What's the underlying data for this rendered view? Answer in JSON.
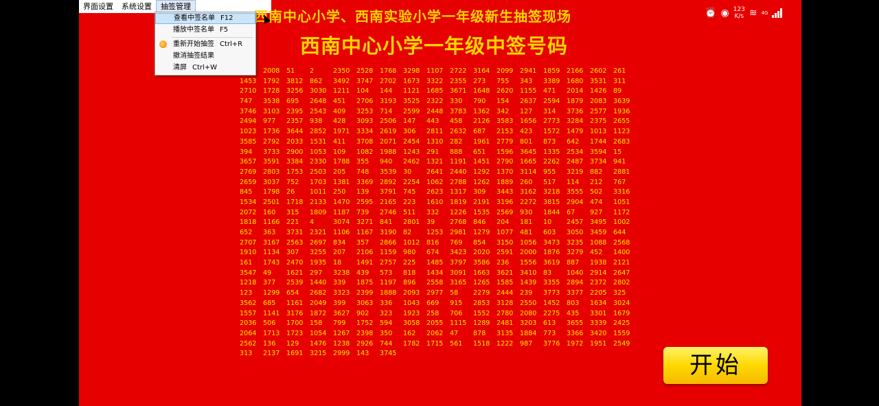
{
  "menubar": {
    "items": [
      "界面设置",
      "系统设置",
      "抽签管理"
    ]
  },
  "dropdown": {
    "items": [
      {
        "label": "查看中签名单",
        "shortcut": "F12"
      },
      {
        "label": "播放中签名单",
        "shortcut": "F5"
      },
      {
        "label": "重新开始抽签",
        "shortcut": "Ctrl+R"
      },
      {
        "label": "撤消抽签结果",
        "shortcut": ""
      },
      {
        "label": "清屏",
        "shortcut": "Ctrl+W"
      }
    ]
  },
  "title1": "西南中心小学、西南实验小学一年级新生抽签现场",
  "title2": "西南中心小学一年级中签号码",
  "start_button": "开始",
  "status": {
    "speed_value": "123",
    "speed_unit": "K/s",
    "network": "4G"
  },
  "numbers": [
    2008,
    51,
    2,
    2350,
    2528,
    1768,
    3298,
    1107,
    2722,
    3164,
    2099,
    2941,
    1859,
    2166,
    2602,
    261,
    1453,
    1792,
    3812,
    862,
    3492,
    3747,
    2702,
    1673,
    3322,
    2355,
    273,
    755,
    343,
    3389,
    1680,
    3531,
    311,
    2710,
    1728,
    3256,
    3030,
    1211,
    104,
    144,
    1121,
    1685,
    3671,
    1648,
    2620,
    1155,
    471,
    2014,
    1426,
    89,
    747,
    3538,
    695,
    2648,
    451,
    2706,
    3193,
    3525,
    2322,
    330,
    790,
    154,
    2637,
    2594,
    1879,
    2083,
    3639,
    3746,
    3103,
    2395,
    2543,
    409,
    3253,
    714,
    2599,
    2448,
    3783,
    1362,
    342,
    127,
    314,
    3736,
    2577,
    1936,
    2494,
    977,
    2357,
    938,
    428,
    3093,
    2506,
    147,
    443,
    458,
    2126,
    3583,
    1656,
    2773,
    3284,
    2375,
    2655,
    1023,
    1736,
    3644,
    2852,
    1971,
    3334,
    2619,
    306,
    2811,
    2632,
    687,
    2153,
    423,
    1572,
    1479,
    1013,
    1123,
    3585,
    2792,
    2033,
    1531,
    411,
    3708,
    2071,
    2454,
    1310,
    282,
    1961,
    2779,
    801,
    873,
    642,
    1744,
    2683,
    394,
    3733,
    2900,
    1053,
    109,
    1082,
    1988,
    1243,
    291,
    888,
    651,
    1596,
    3645,
    1335,
    2534,
    3594,
    15,
    3657,
    3591,
    3384,
    2330,
    1788,
    355,
    940,
    2462,
    1321,
    1191,
    1451,
    2790,
    1665,
    2262,
    2487,
    3734,
    941,
    2769,
    2803,
    1753,
    2503,
    205,
    748,
    3539,
    30,
    2641,
    2440,
    1292,
    1370,
    3114,
    955,
    3219,
    882,
    2881,
    2659,
    3037,
    752,
    1703,
    1381,
    3369,
    2892,
    2254,
    1062,
    2788,
    1262,
    1889,
    260,
    517,
    114,
    212,
    767,
    845,
    1798,
    26,
    1011,
    250,
    139,
    3791,
    745,
    2623,
    1317,
    309,
    3443,
    3162,
    3218,
    3555,
    502,
    3316,
    1534,
    2501,
    1718,
    2133,
    1470,
    2595,
    2165,
    223,
    1610,
    1819,
    2191,
    3196,
    2272,
    3815,
    2904,
    474,
    1051,
    2072,
    160,
    315,
    1809,
    1187,
    739,
    2746,
    511,
    332,
    1226,
    1535,
    2569,
    930,
    1844,
    67,
    927,
    1172,
    1818,
    1166,
    221,
    4,
    3074,
    3271,
    841,
    2801,
    39,
    2768,
    846,
    204,
    181,
    10,
    2457,
    3495,
    1002,
    652,
    363,
    3731,
    2321,
    1106,
    1167,
    3190,
    82,
    1253,
    2981,
    1279,
    1077,
    481,
    603,
    3050,
    3459,
    644,
    2707,
    3167,
    2563,
    2697,
    834,
    357,
    2866,
    1012,
    816,
    769,
    854,
    3150,
    1056,
    3473,
    3235,
    1088,
    2568,
    1910,
    1134,
    307,
    3255,
    207,
    2106,
    1159,
    980,
    674,
    3423,
    2020,
    2591,
    2000,
    1876,
    3279,
    452,
    1400,
    161,
    1743,
    2470,
    1935,
    18,
    1491,
    2757,
    225,
    1485,
    3797,
    3586,
    236,
    1556,
    3619,
    887,
    1938,
    2121,
    3547,
    49,
    1621,
    297,
    3238,
    439,
    573,
    818,
    1434,
    3091,
    1663,
    3621,
    3410,
    83,
    1040,
    2914,
    2647,
    1218,
    377,
    2539,
    1440,
    339,
    1875,
    1197,
    896,
    2558,
    3165,
    1265,
    1585,
    1439,
    3355,
    2894,
    2372,
    2802,
    123,
    1299,
    654,
    2682,
    3323,
    2399,
    1888,
    2093,
    2977,
    58,
    2279,
    2444,
    239,
    3773,
    3377,
    2205,
    325,
    3562,
    685,
    1161,
    2049,
    399,
    3063,
    336,
    1043,
    669,
    915,
    2853,
    3128,
    2550,
    1452,
    803,
    1634,
    3024,
    1557,
    1141,
    3176,
    1872,
    3627,
    902,
    323,
    1923,
    258,
    706,
    1552,
    2780,
    2080,
    2275,
    435,
    3301,
    1679,
    2036,
    506,
    1700,
    158,
    799,
    1752,
    594,
    3058,
    2055,
    1115,
    1289,
    2481,
    3203,
    613,
    3655,
    3339,
    2425,
    2064,
    1713,
    1723,
    1054,
    1267,
    2398,
    350,
    162,
    2062,
    47,
    878,
    3135,
    1884,
    773,
    3366,
    3420,
    1559,
    2562,
    136,
    129,
    1476,
    1238,
    2926,
    744,
    1782,
    1715,
    561,
    1518,
    1222,
    987,
    3776,
    1972,
    1951,
    2549,
    313,
    2137,
    1691,
    3215,
    2999,
    143,
    3745
  ]
}
